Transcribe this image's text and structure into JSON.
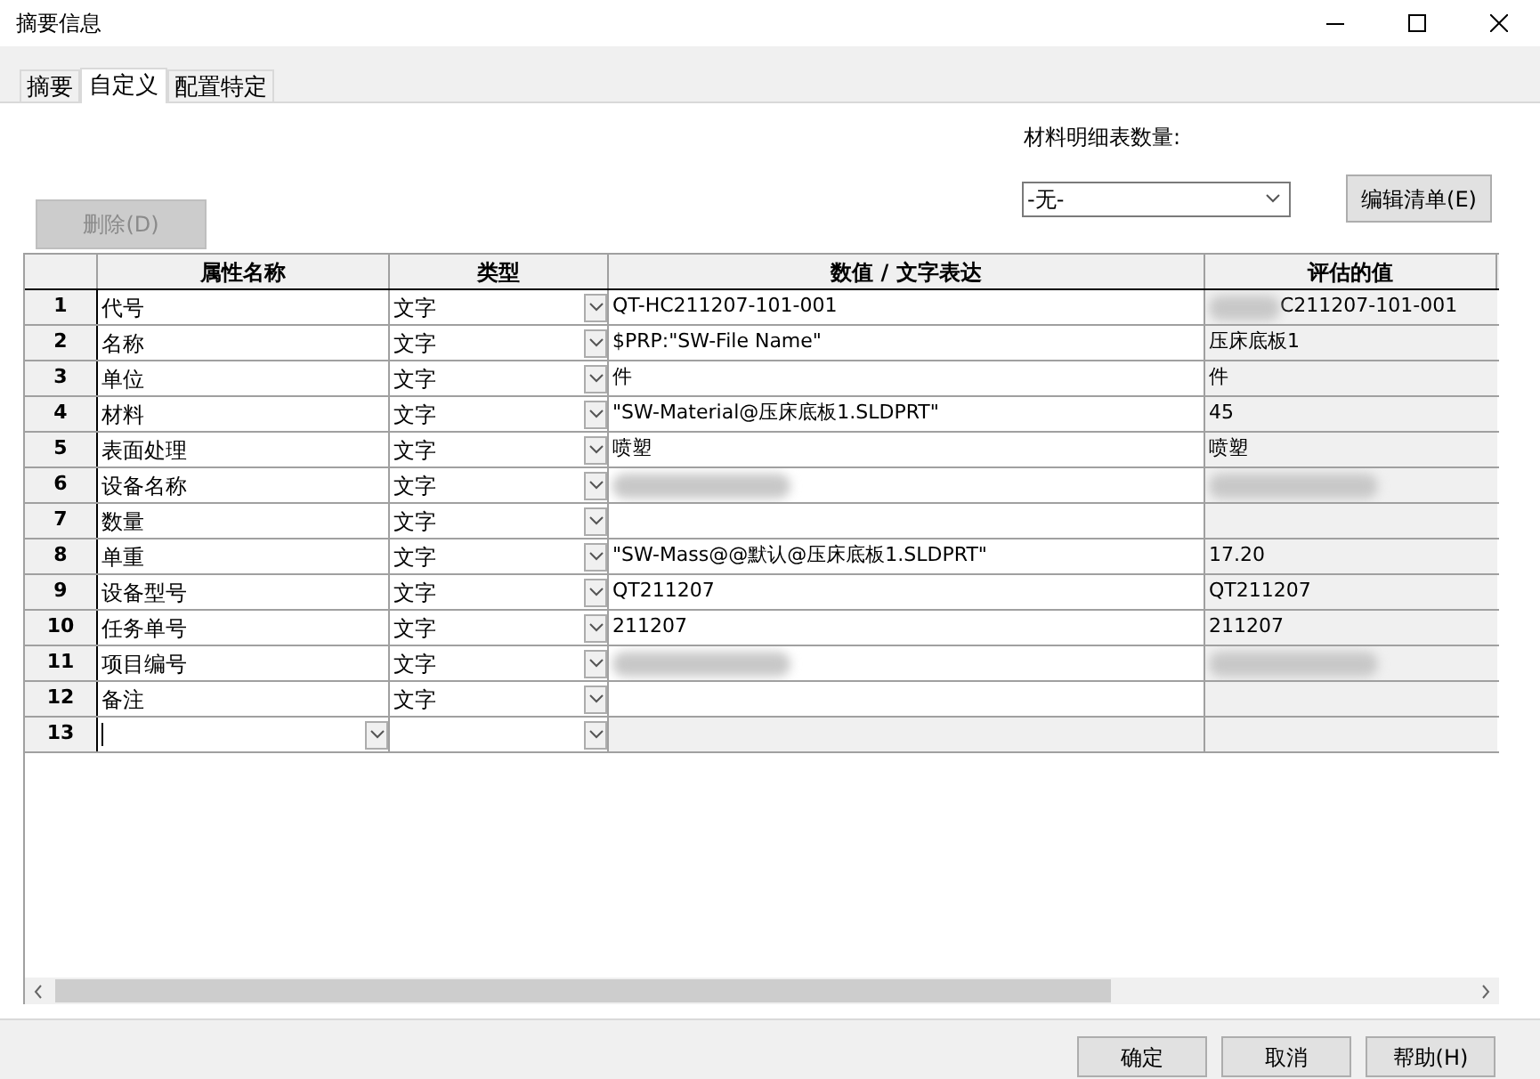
{
  "window": {
    "title": "摘要信息"
  },
  "tabs": [
    {
      "label": "摘要",
      "selected": false
    },
    {
      "label": "自定义",
      "selected": true
    },
    {
      "label": "配置特定",
      "selected": false
    }
  ],
  "delete_button": {
    "label": "删除(D)",
    "disabled": true
  },
  "bom_quantity": {
    "label": "材料明细表数量:",
    "value": "-无-"
  },
  "edit_list_button": {
    "label": "编辑清单(E)"
  },
  "table": {
    "columns": [
      "属性名称",
      "类型",
      "数值 / 文字表达",
      "评估的值"
    ],
    "rows": [
      {
        "kind": "property",
        "number": "1",
        "name": "代号",
        "type": "文字",
        "value": "QT-HC211207-101-001",
        "value_redacted": false,
        "evaluated": "C211207-101-001",
        "evaluated_redacted": true
      },
      {
        "kind": "property",
        "number": "2",
        "name": "名称",
        "type": "文字",
        "value": "$PRP:\"SW-File Name\"",
        "value_redacted": false,
        "evaluated": "压床底板1",
        "evaluated_redacted": false
      },
      {
        "kind": "property",
        "number": "3",
        "name": "单位",
        "type": "文字",
        "value": "件",
        "value_redacted": false,
        "evaluated": "件",
        "evaluated_redacted": false
      },
      {
        "kind": "property",
        "number": "4",
        "name": "材料",
        "type": "文字",
        "value": "\"SW-Material@压床底板1.SLDPRT\"",
        "value_redacted": false,
        "evaluated": "45",
        "evaluated_redacted": false
      },
      {
        "kind": "property",
        "number": "5",
        "name": "表面处理",
        "type": "文字",
        "value": "喷塑",
        "value_redacted": false,
        "evaluated": "喷塑",
        "evaluated_redacted": false
      },
      {
        "kind": "property",
        "number": "6",
        "name": "设备名称",
        "type": "文字",
        "value_redacted": true,
        "evaluated_redacted": true
      },
      {
        "kind": "property",
        "number": "7",
        "name": "数量",
        "type": "文字",
        "value_redacted": false,
        "evaluated_redacted": false
      },
      {
        "kind": "property",
        "number": "8",
        "name": "单重",
        "type": "文字",
        "value": "\"SW-Mass@@默认@压床底板1.SLDPRT\"",
        "value_redacted": false,
        "evaluated": "17.20",
        "evaluated_redacted": false
      },
      {
        "kind": "property",
        "number": "9",
        "name": "设备型号",
        "type": "文字",
        "value": "QT211207",
        "value_redacted": false,
        "evaluated": "QT211207",
        "evaluated_redacted": false
      },
      {
        "kind": "property",
        "number": "10",
        "name": "任务单号",
        "type": "文字",
        "value": "211207",
        "value_redacted": false,
        "evaluated": "211207",
        "evaluated_redacted": false
      },
      {
        "kind": "property",
        "number": "11",
        "name": "项目编号",
        "type": "文字",
        "value_redacted": true,
        "evaluated_redacted": true
      },
      {
        "kind": "property",
        "number": "12",
        "name": "备注",
        "type": "文字",
        "value_redacted": false,
        "evaluated_redacted": false
      },
      {
        "kind": "new",
        "number": "13"
      }
    ]
  },
  "buttons": [
    {
      "label": "确定"
    },
    {
      "label": "取消"
    },
    {
      "label": "帮助(H)"
    }
  ]
}
